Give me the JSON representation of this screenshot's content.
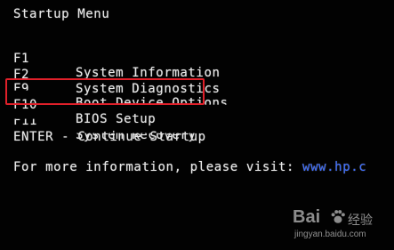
{
  "menu": {
    "title": "Startup Menu",
    "items": [
      {
        "key": "F1",
        "label": "System Information"
      },
      {
        "key": "F2",
        "label": "System Diagnostics"
      },
      {
        "key": "F9",
        "label": "Boot Device Options"
      },
      {
        "key": "F10",
        "label": "BIOS Setup"
      },
      {
        "key": "F11",
        "label": "System Recovery"
      }
    ],
    "enter_text": "ENTER - Continue Startup",
    "info_text": "For more information, please visit: ",
    "info_link": "www.hp.c"
  },
  "watermark": {
    "brand": "Bai",
    "suffix": "经验",
    "url": "jingyan.baidu.com"
  },
  "colors": {
    "background": "#020202",
    "text": "#e8e8e8",
    "link": "#3b6cff",
    "highlight": "#e0202a"
  }
}
